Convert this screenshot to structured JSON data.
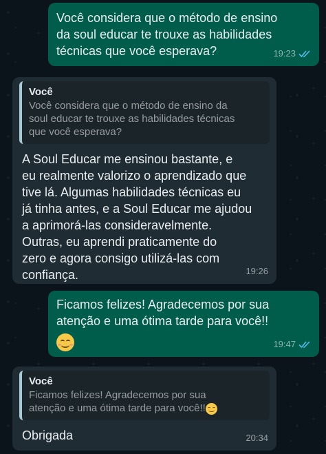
{
  "messages": {
    "m1": {
      "text": "Você considera que o método de ensino\nda soul educar  te trouxe as habilidades\ntécnicas que você esperava?",
      "time": "19:23"
    },
    "m2": {
      "quote_author": "Você",
      "quote_text": "Você considera que o método de ensino da\nsoul educar  te trouxe as habilidades técnicas\nque você esperava?",
      "text": "A Soul Educar me ensinou bastante, e\neu realmente valorizo o aprendizado que\ntive lá.  Algumas habilidades técnicas eu\njá tinha antes, e a Soul Educar me ajudou\na aprimorá-las consideravelmente.\nOutras, eu aprendi praticamente do\nzero e agora consigo utilizá-las com\nconfiança.",
      "time": "19:26"
    },
    "m3": {
      "text": "Ficamos felizes! Agradecemos por sua\natenção e uma ótima tarde para você!!",
      "emoji": "smiling-face-emoji",
      "time": "19:47"
    },
    "m4": {
      "quote_author": "Você",
      "quote_text": "Ficamos felizes! Agradecemos por sua\natenção e uma ótima tarde para você!!",
      "text": "Obrigada",
      "time": "20:34"
    }
  },
  "colors": {
    "background": "#0b141a",
    "outgoing_bubble": "#005c4b",
    "incoming_bubble": "#202c33",
    "read_ticks": "#53bdeb"
  }
}
